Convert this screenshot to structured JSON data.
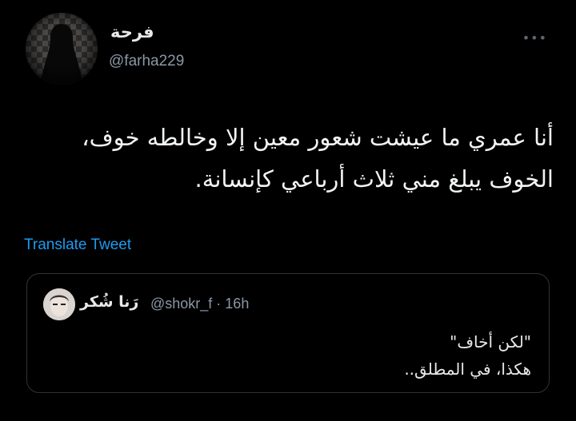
{
  "author": {
    "display_name": "فرحة",
    "handle": "@farha229"
  },
  "more_icon": "more-horizontal-icon",
  "tweet": {
    "text": "أنا عمري ما عيشت شعور معين إلا وخالطه خوف، الخوف يبلغ مني ثلاث أرباعي كإنسانة."
  },
  "translate_label": "Translate Tweet",
  "quoted": {
    "display_name": "رَنا شُكر",
    "handle_time": "@shokr_f · 16h",
    "lines": [
      "\"لكن أخاف\"",
      "هكذا، في المطلق.."
    ]
  },
  "colors": {
    "background": "#000000",
    "link": "#1d9bf0",
    "secondary_text": "#8b98a5",
    "border": "#2f3336"
  }
}
